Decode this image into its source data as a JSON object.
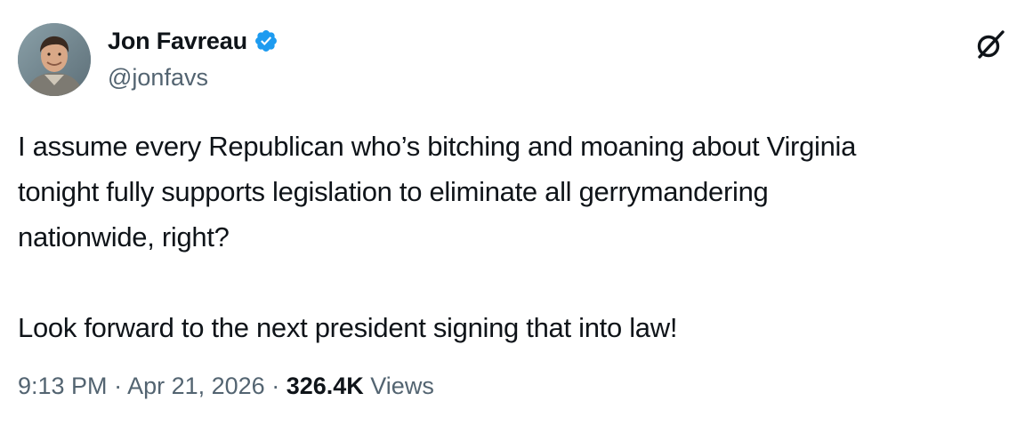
{
  "author": {
    "display_name": "Jon Favreau",
    "handle": "@jonfavs",
    "verified": true
  },
  "tweet": {
    "line1": "I assume every Republican who’s bitching and moaning about Virginia",
    "line2": "tonight fully supports legislation to eliminate all gerrymandering",
    "line3": "nationwide, right?",
    "line4": "Look forward to the next president signing that into law!"
  },
  "meta": {
    "time": "9:13 PM",
    "separator": " · ",
    "date": "Apr 21, 2026",
    "views_count": "326.4K",
    "views_label": " Views"
  },
  "icons": {
    "verified": "verified-badge-icon",
    "grok": "grok-icon"
  },
  "colors": {
    "verified": "#1d9bf0",
    "text": "#0f1419",
    "secondary": "#536471"
  }
}
